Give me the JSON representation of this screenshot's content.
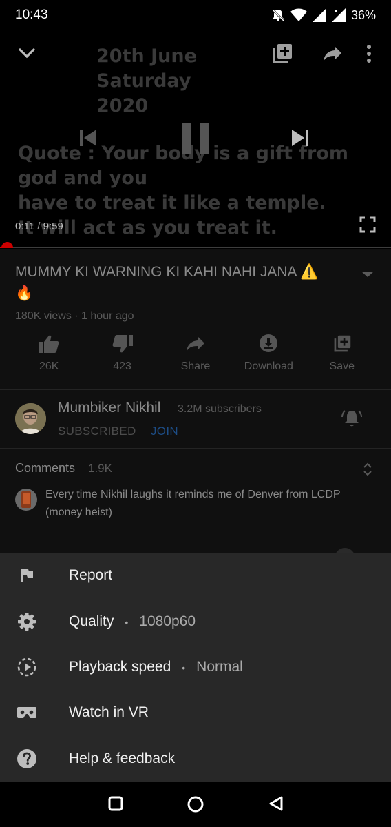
{
  "status_bar": {
    "time": "10:43",
    "battery": "36%"
  },
  "player": {
    "overlay_date_lines": [
      "20th June",
      "Saturday",
      "2020"
    ],
    "overlay_quote_lines": [
      "Quote : Your body is a gift from god and you",
      "have to treat it like a temple.",
      "It will act as you treat it."
    ],
    "current_time": "0:11",
    "separator": " / ",
    "duration": "9:59",
    "progress_fraction": 0.018
  },
  "video": {
    "title": "MUMMY KI WARNING KI KAHI NAHI JANA ⚠️ 🔥",
    "meta": "180K views · 1 hour ago"
  },
  "actions": [
    {
      "label": "26K",
      "icon": "thumbs-up-icon"
    },
    {
      "label": "423",
      "icon": "thumbs-down-icon"
    },
    {
      "label": "Share",
      "icon": "share-icon"
    },
    {
      "label": "Download",
      "icon": "download-icon"
    },
    {
      "label": "Save",
      "icon": "playlist-add-icon"
    }
  ],
  "channel": {
    "name": "Mumbiker Nikhil",
    "subscribers": "3.2M subscribers",
    "subscribed_label": "SUBSCRIBED",
    "join_label": "JOIN"
  },
  "comments": {
    "label": "Comments",
    "count": "1.9K",
    "top_comment": "Every time Nikhil laughs it reminds me of Denver from LCDP (money heist)"
  },
  "menu": {
    "report": "Report",
    "quality": "Quality",
    "quality_value": "1080p60",
    "playback_speed": "Playback speed",
    "playback_speed_value": "Normal",
    "watch_vr": "Watch in VR",
    "help": "Help & feedback",
    "dot": "•"
  },
  "colors": {
    "accent_red": "#cc0000",
    "sheet_bg": "#282828",
    "join_blue": "#1d4d86"
  }
}
